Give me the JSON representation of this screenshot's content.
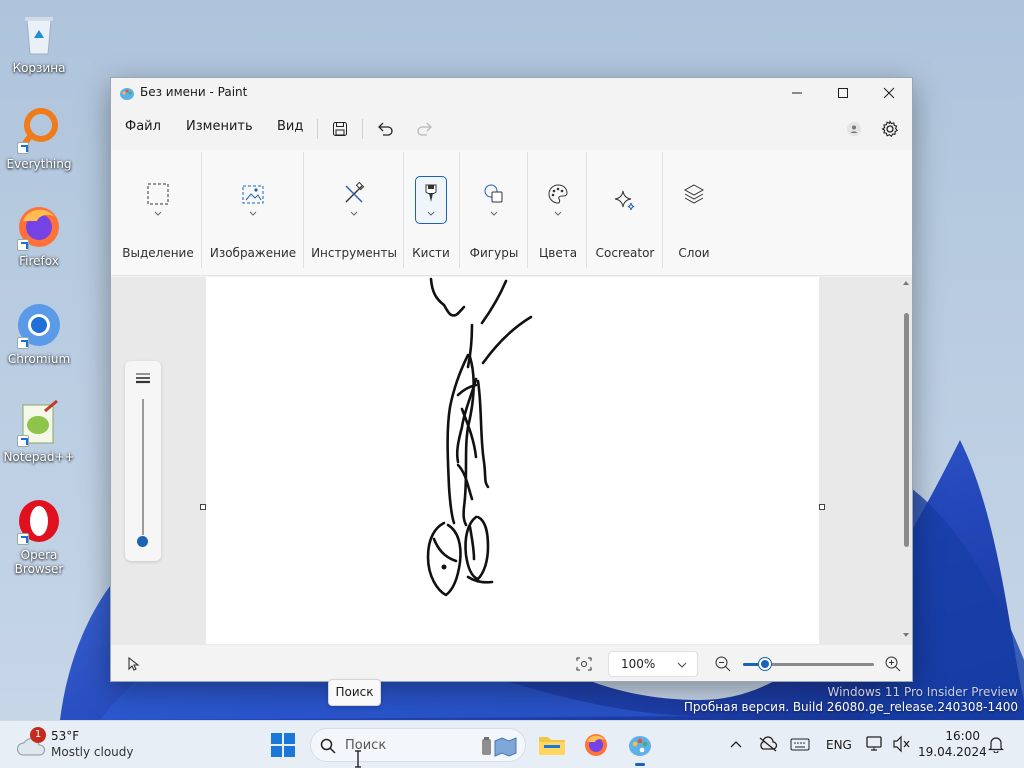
{
  "desktop": {
    "icons": [
      {
        "label": "Корзина",
        "icon": "recycle-bin-icon"
      },
      {
        "label": "Everything",
        "icon": "everything-search-icon"
      },
      {
        "label": "Firefox",
        "icon": "firefox-icon"
      },
      {
        "label": "Chromium",
        "icon": "chromium-icon"
      },
      {
        "label": "Notepad++",
        "icon": "notepadpp-icon"
      },
      {
        "label": "Opera Browser",
        "icon": "opera-icon"
      }
    ]
  },
  "window": {
    "title": "Без имени - Paint",
    "menu": {
      "file": "Файл",
      "edit": "Изменить",
      "view": "Вид"
    },
    "ribbon": {
      "selection": "Выделение",
      "image": "Изображение",
      "tools": "Инструменты",
      "brushes": "Кисти",
      "shapes": "Фигуры",
      "colors": "Цвета",
      "cocreator": "Cocreator",
      "layers": "Слои"
    },
    "status": {
      "zoom": "100%",
      "zoom_level": 0.17
    }
  },
  "tooltip": "Поиск",
  "watermark": {
    "line1": "Windows 11 Pro Insider Preview",
    "line2": "Пробная версия. Build 26080.ge_release.240308-1400"
  },
  "taskbar": {
    "weather": {
      "temp": "53°F",
      "condition": "Mostly cloudy",
      "badge": "1"
    },
    "search_placeholder": "Поиск",
    "language": "ENG",
    "time": "16:00",
    "date": "19.04.2024"
  },
  "colors": {
    "accent": "#1a63b6",
    "taskbar": "#e8eef5"
  }
}
